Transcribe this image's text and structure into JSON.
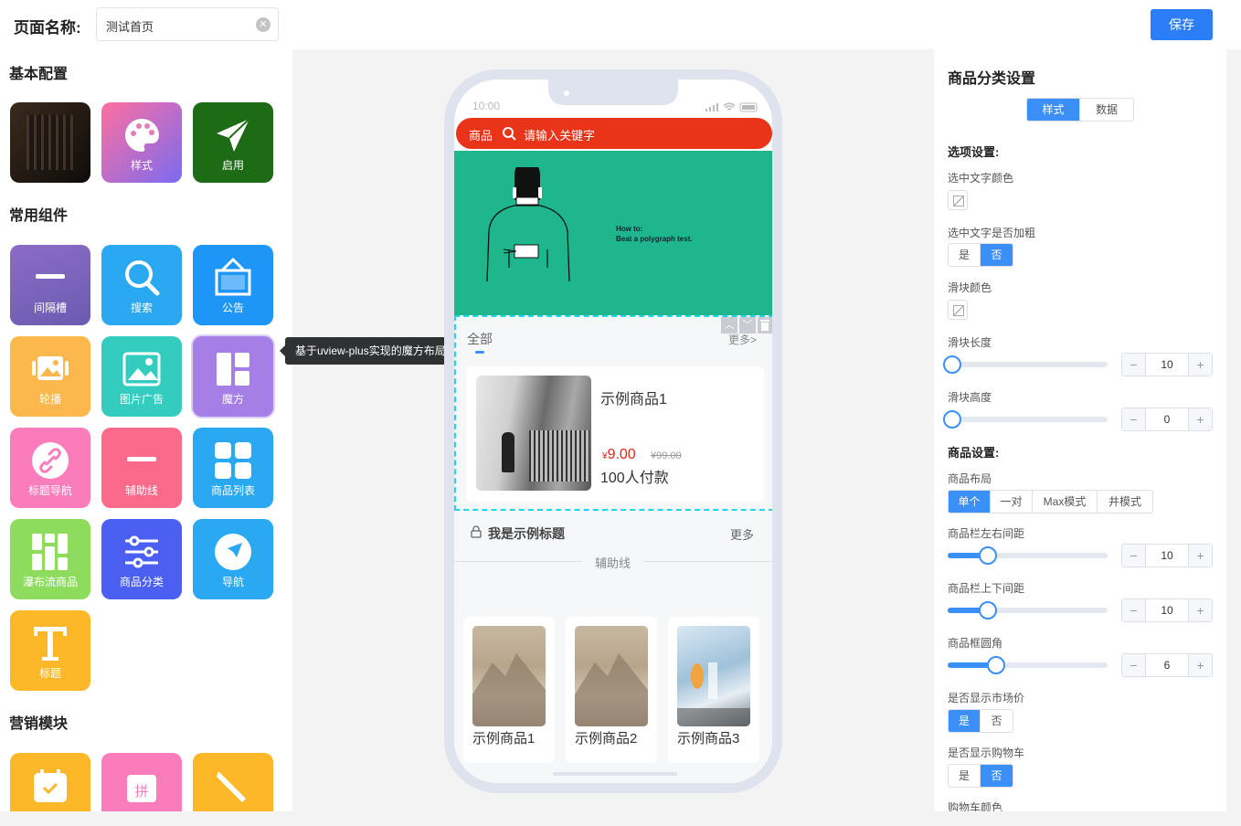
{
  "header": {
    "page_name_label": "页面名称:",
    "page_name_value": "测试首页",
    "save_label": "保存"
  },
  "left": {
    "basic_title": "基本配置",
    "basic_items": [
      {
        "label": ""
      },
      {
        "label": "样式"
      },
      {
        "label": "启用"
      }
    ],
    "common_title": "常用组件",
    "common_items": [
      {
        "label": "间隔槽"
      },
      {
        "label": "搜索"
      },
      {
        "label": "公告"
      },
      {
        "label": "轮播"
      },
      {
        "label": "图片广告"
      },
      {
        "label": "魔方"
      },
      {
        "label": "标题导航"
      },
      {
        "label": "辅助线"
      },
      {
        "label": "商品列表"
      },
      {
        "label": "瀑布流商品"
      },
      {
        "label": "商品分类"
      },
      {
        "label": "导航"
      },
      {
        "label": "标题"
      }
    ],
    "marketing_title": "营销模块",
    "tooltip": "基于uview-plus实现的魔方布局"
  },
  "phone": {
    "time": "10:00",
    "search": {
      "tag": "商品",
      "placeholder": "请输入关键字"
    },
    "banner": {
      "line1": "How to:",
      "line2": "Beat a polygraph test."
    },
    "category": {
      "tab": "全部",
      "more": "更多>",
      "product": {
        "name": "示例商品1",
        "price": "9.00",
        "currency": "¥",
        "market_price": "¥99.00",
        "sales": "100人付款"
      }
    },
    "title_block": {
      "title": "我是示例标题",
      "more": "更多"
    },
    "divider_label": "辅助线",
    "goods": [
      {
        "name": "示例商品1"
      },
      {
        "name": "示例商品2"
      },
      {
        "name": "示例商品3"
      }
    ]
  },
  "right": {
    "title": "商品分类设置",
    "tabs": [
      "样式",
      "数据"
    ],
    "option_heading": "选项设置:",
    "selected_text_color": "选中文字颜色",
    "selected_text_bold": "选中文字是否加粗",
    "yes": "是",
    "no": "否",
    "slider_color": "滑块颜色",
    "slider_length": {
      "label": "滑块长度",
      "value": "10"
    },
    "slider_height": {
      "label": "滑块高度",
      "value": "0"
    },
    "goods_heading": "商品设置:",
    "goods_layout": {
      "label": "商品布局",
      "options": [
        "单个",
        "一对",
        "Max模式",
        "井模式"
      ]
    },
    "goods_lr_margin": {
      "label": "商品栏左右间距",
      "value": "10"
    },
    "goods_tb_margin": {
      "label": "商品栏上下间距",
      "value": "10"
    },
    "goods_radius": {
      "label": "商品框圆角",
      "value": "6"
    },
    "show_market_price": "是否显示市场价",
    "show_cart": "是否显示购物车",
    "cart_color": "购物车颜色"
  }
}
